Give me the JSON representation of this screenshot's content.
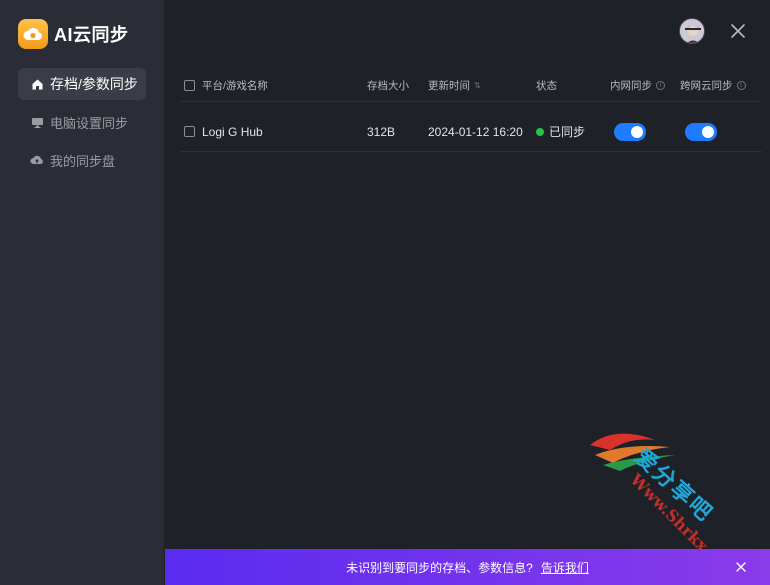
{
  "app": {
    "name": "AI云同步"
  },
  "sidebar": {
    "items": [
      {
        "label": "存档/参数同步",
        "icon": "home-icon",
        "active": true
      },
      {
        "label": "电脑设置同步",
        "icon": "monitor-icon",
        "active": false
      },
      {
        "label": "我的同步盘",
        "icon": "cloud-upload-icon",
        "active": false
      }
    ]
  },
  "table": {
    "headers": {
      "name": "平台/游戏名称",
      "size": "存档大小",
      "updated": "更新时间",
      "status": "状态",
      "lan": "内网同步",
      "cross": "跨网云同步"
    },
    "rows": [
      {
        "name": "Logi G Hub",
        "size": "312B",
        "updated": "2024-01-12 16:20",
        "status": "已同步",
        "lan_enabled": true,
        "cross_enabled": true
      }
    ]
  },
  "banner": {
    "text": "未识别到要同步的存档、参数信息?",
    "link": "告诉我们"
  },
  "watermark": {
    "text": "爱分享吧",
    "url": "Www.Shrkx.Com"
  },
  "colors": {
    "accent": "#1f7bff",
    "status_ok": "#27c24c",
    "banner_start": "#5a2bf0",
    "banner_end": "#8a3bea",
    "logo": "#f6a823"
  }
}
